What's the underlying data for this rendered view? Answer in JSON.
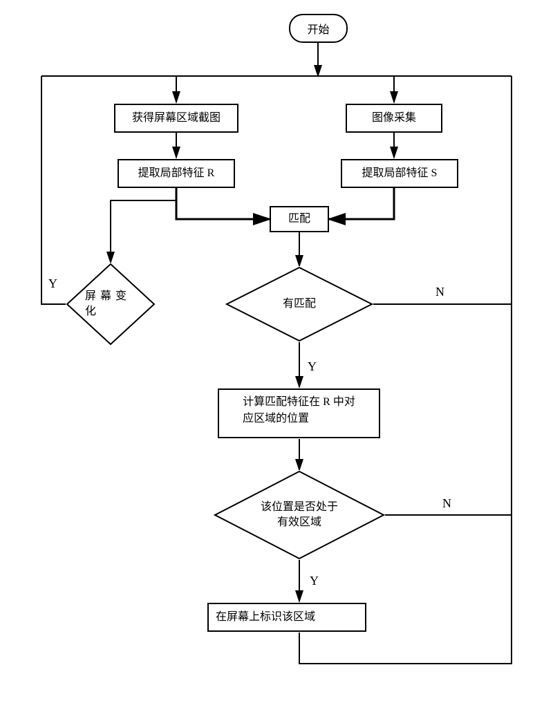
{
  "chart_data": {
    "type": "flowchart",
    "nodes": [
      {
        "id": "start",
        "type": "terminator",
        "label": "开始"
      },
      {
        "id": "cap_screen",
        "type": "process",
        "label": "获得屏幕区域截图"
      },
      {
        "id": "cap_image",
        "type": "process",
        "label": "图像采集"
      },
      {
        "id": "feat_r",
        "type": "process",
        "label": "提取局部特征 R"
      },
      {
        "id": "feat_s",
        "type": "process",
        "label": "提取局部特征 S"
      },
      {
        "id": "match",
        "type": "process",
        "label": "匹配"
      },
      {
        "id": "screen_change",
        "type": "decision",
        "label": "屏幕变化"
      },
      {
        "id": "has_match",
        "type": "decision",
        "label": "有匹配"
      },
      {
        "id": "calc_pos",
        "type": "process",
        "label": "计算匹配特征在 R 中对\n应区域的位置"
      },
      {
        "id": "in_valid",
        "type": "decision",
        "label": "该位置是否处于\n有效区域"
      },
      {
        "id": "mark",
        "type": "process",
        "label": "在屏幕上标识该区域"
      }
    ],
    "edges": [
      {
        "from": "start",
        "to": "split"
      },
      {
        "from": "split",
        "to": "cap_screen"
      },
      {
        "from": "split",
        "to": "cap_image"
      },
      {
        "from": "cap_screen",
        "to": "feat_r"
      },
      {
        "from": "cap_image",
        "to": "feat_s"
      },
      {
        "from": "feat_r",
        "to": "match"
      },
      {
        "from": "feat_s",
        "to": "match"
      },
      {
        "from": "feat_r",
        "to": "screen_change"
      },
      {
        "from": "screen_change",
        "to": "split_left",
        "label": "Y"
      },
      {
        "from": "match",
        "to": "has_match"
      },
      {
        "from": "has_match",
        "to": "split_right",
        "label": "N"
      },
      {
        "from": "has_match",
        "to": "calc_pos",
        "label": "Y"
      },
      {
        "from": "calc_pos",
        "to": "in_valid"
      },
      {
        "from": "in_valid",
        "to": "split_right",
        "label": "N"
      },
      {
        "from": "in_valid",
        "to": "mark",
        "label": "Y"
      },
      {
        "from": "mark",
        "to": "split_right"
      }
    ]
  },
  "labels": {
    "y1": "Y",
    "y2": "Y",
    "y3": "Y",
    "n1": "N",
    "n2": "N"
  },
  "nodes": {
    "start": "开始",
    "cap_screen": "获得屏幕区域截图",
    "cap_image": "图像采集",
    "feat_r": "提取局部特征 R",
    "feat_s": "提取局部特征 S",
    "match": "匹配",
    "screen_change_l1": "屏幕变",
    "screen_change_l2": "化",
    "has_match": "有匹配",
    "calc_pos_l1": "计算匹配特征在 R 中对",
    "calc_pos_l2": "应区域的位置",
    "in_valid_l1": "该位置是否处于",
    "in_valid_l2": "有效区域",
    "mark": "在屏幕上标识该区域"
  }
}
